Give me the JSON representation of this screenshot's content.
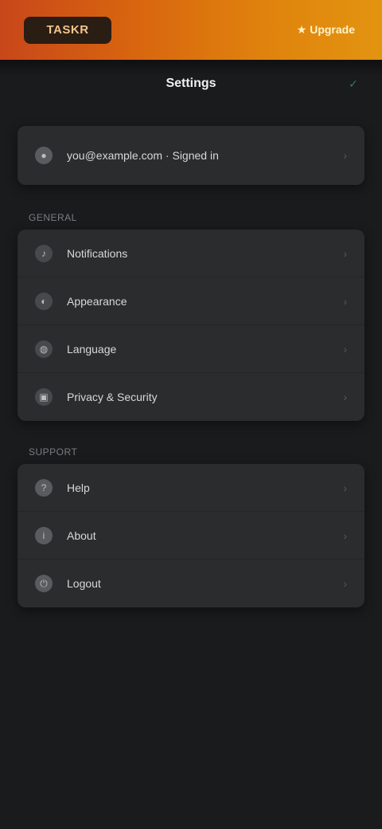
{
  "topbar": {
    "brand": "TASKR",
    "action_label": "★ Upgrade",
    "accent": "#e0830e"
  },
  "nav": {
    "title": "Settings",
    "right_icon": "check-icon"
  },
  "account": {
    "label": "you@example.com · Signed in"
  },
  "section_general": {
    "title": "GENERAL",
    "items": [
      {
        "label": "Notifications",
        "icon": "bell-icon",
        "glyph": "🔔"
      },
      {
        "label": "Appearance",
        "icon": "palette-icon",
        "glyph": "◐"
      },
      {
        "label": "Language",
        "icon": "globe-icon",
        "glyph": "◍"
      },
      {
        "label": "Privacy & Security",
        "icon": "lock-icon",
        "glyph": "🔒"
      }
    ]
  },
  "section_support": {
    "title": "SUPPORT",
    "items": [
      {
        "label": "Help",
        "icon": "help-icon",
        "glyph": "?"
      },
      {
        "label": "About",
        "icon": "info-icon",
        "glyph": "i"
      },
      {
        "label": "Logout",
        "icon": "logout-icon",
        "glyph": "⏻"
      }
    ]
  }
}
